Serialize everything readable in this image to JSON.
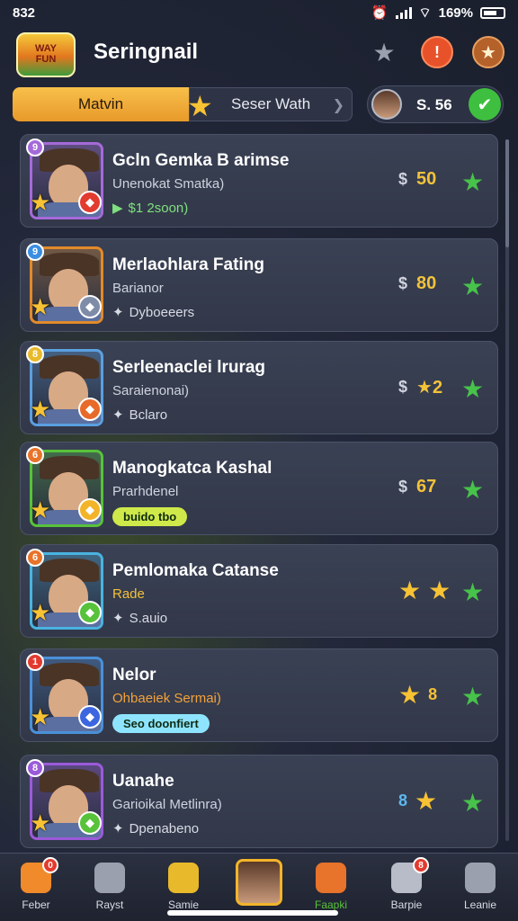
{
  "status": {
    "time": "832",
    "battery": "169%"
  },
  "header": {
    "logo_text": "WAY\nFUN",
    "title": "Seringnail"
  },
  "tabs": {
    "active": "Matvin",
    "inactive": "Seser Wath"
  },
  "currency": {
    "amount": "S. 56",
    "add": "✔"
  },
  "cards": [
    {
      "rank": "9",
      "name": "Gcln Gemka B arimse",
      "sub": "Unenokat Smatka)",
      "tag": "$1 2soon)",
      "tag_icon": "▶",
      "price_cur": "$",
      "price": "50",
      "rank_color": "#a56ad9",
      "frame": "#a56ad9",
      "tag_color": "#7ee07e",
      "gem_color": "#e23b2f"
    },
    {
      "rank": "9",
      "name": "Merlaohlara Fating",
      "sub": "Barianor",
      "tag": "Dyboeeers",
      "tag_icon": "✦",
      "price_cur": "$",
      "price": "80",
      "rank_color": "#3b8ee0",
      "frame": "#e28a2a",
      "tag_color": "#d8dbe5",
      "gem_color": "#7f8ca8"
    },
    {
      "rank": "8",
      "name": "Serleenaclei lrurag",
      "sub": "Saraienonai)",
      "tag": "Bclaro",
      "tag_icon": "✦",
      "price_cur": "$",
      "price": "★2",
      "rank_color": "#e8b92a",
      "frame": "#5b9fe0",
      "tag_color": "#d8dbe5",
      "gem_color": "#e86a2a"
    },
    {
      "rank": "6",
      "name": "Manogkatca Kashal",
      "sub": "Prarhdenel",
      "tag": "buido tbo",
      "tag_icon": "",
      "price_cur": "$",
      "price": "67",
      "rank_color": "#e8732a",
      "frame": "#58c23a",
      "tag_color": "#cfe94a",
      "gem_color": "#f3b42a"
    },
    {
      "rank": "6",
      "name": "Pemlomaka Catanse",
      "sub": "Rade",
      "tag": "S.auio",
      "tag_icon": "✦",
      "stars": [
        "★",
        "★"
      ],
      "rank_color": "#e8732a",
      "frame": "#4ab3e0",
      "tag_color": "#d8dbe5",
      "gem_color": "#58c23a",
      "sub_color": "#f3c23a"
    },
    {
      "rank": "1",
      "name": "Nelor",
      "sub": "Ohbaeiek Sermai)",
      "tag": "Seo doonfiert",
      "tag_icon": "",
      "stars": [
        "★",
        "8"
      ],
      "rank_color": "#e23b2f",
      "frame": "#4a90d9",
      "tag_color": "#8ee4ff",
      "gem_color": "#3b66e0",
      "sub_color": "#f3a23a"
    },
    {
      "rank": "8",
      "name": "Uanahe",
      "sub": "Garioikal Metlinra)",
      "tag": "Dpenabeno",
      "tag_icon": "✦",
      "stars": [
        "8",
        "★"
      ],
      "rank_color": "#9b5ad9",
      "frame": "#9b5ad9",
      "tag_color": "#d8dbe5",
      "gem_color": "#58c23a"
    }
  ],
  "nav": [
    {
      "label": "Feber",
      "badge": "0",
      "color": "#f08a2a"
    },
    {
      "label": "Rayst",
      "badge": "",
      "color": "#9aa0ad"
    },
    {
      "label": "Samie",
      "badge": "",
      "color": "#e8b92a"
    },
    {
      "label": "",
      "badge": "",
      "color": ""
    },
    {
      "label": "Faapki",
      "badge": "",
      "color": "#e8732a"
    },
    {
      "label": "Barpie",
      "badge": "8",
      "color": "#b7bcc8"
    },
    {
      "label": "Leanie",
      "badge": "",
      "color": "#9aa0ad"
    }
  ]
}
